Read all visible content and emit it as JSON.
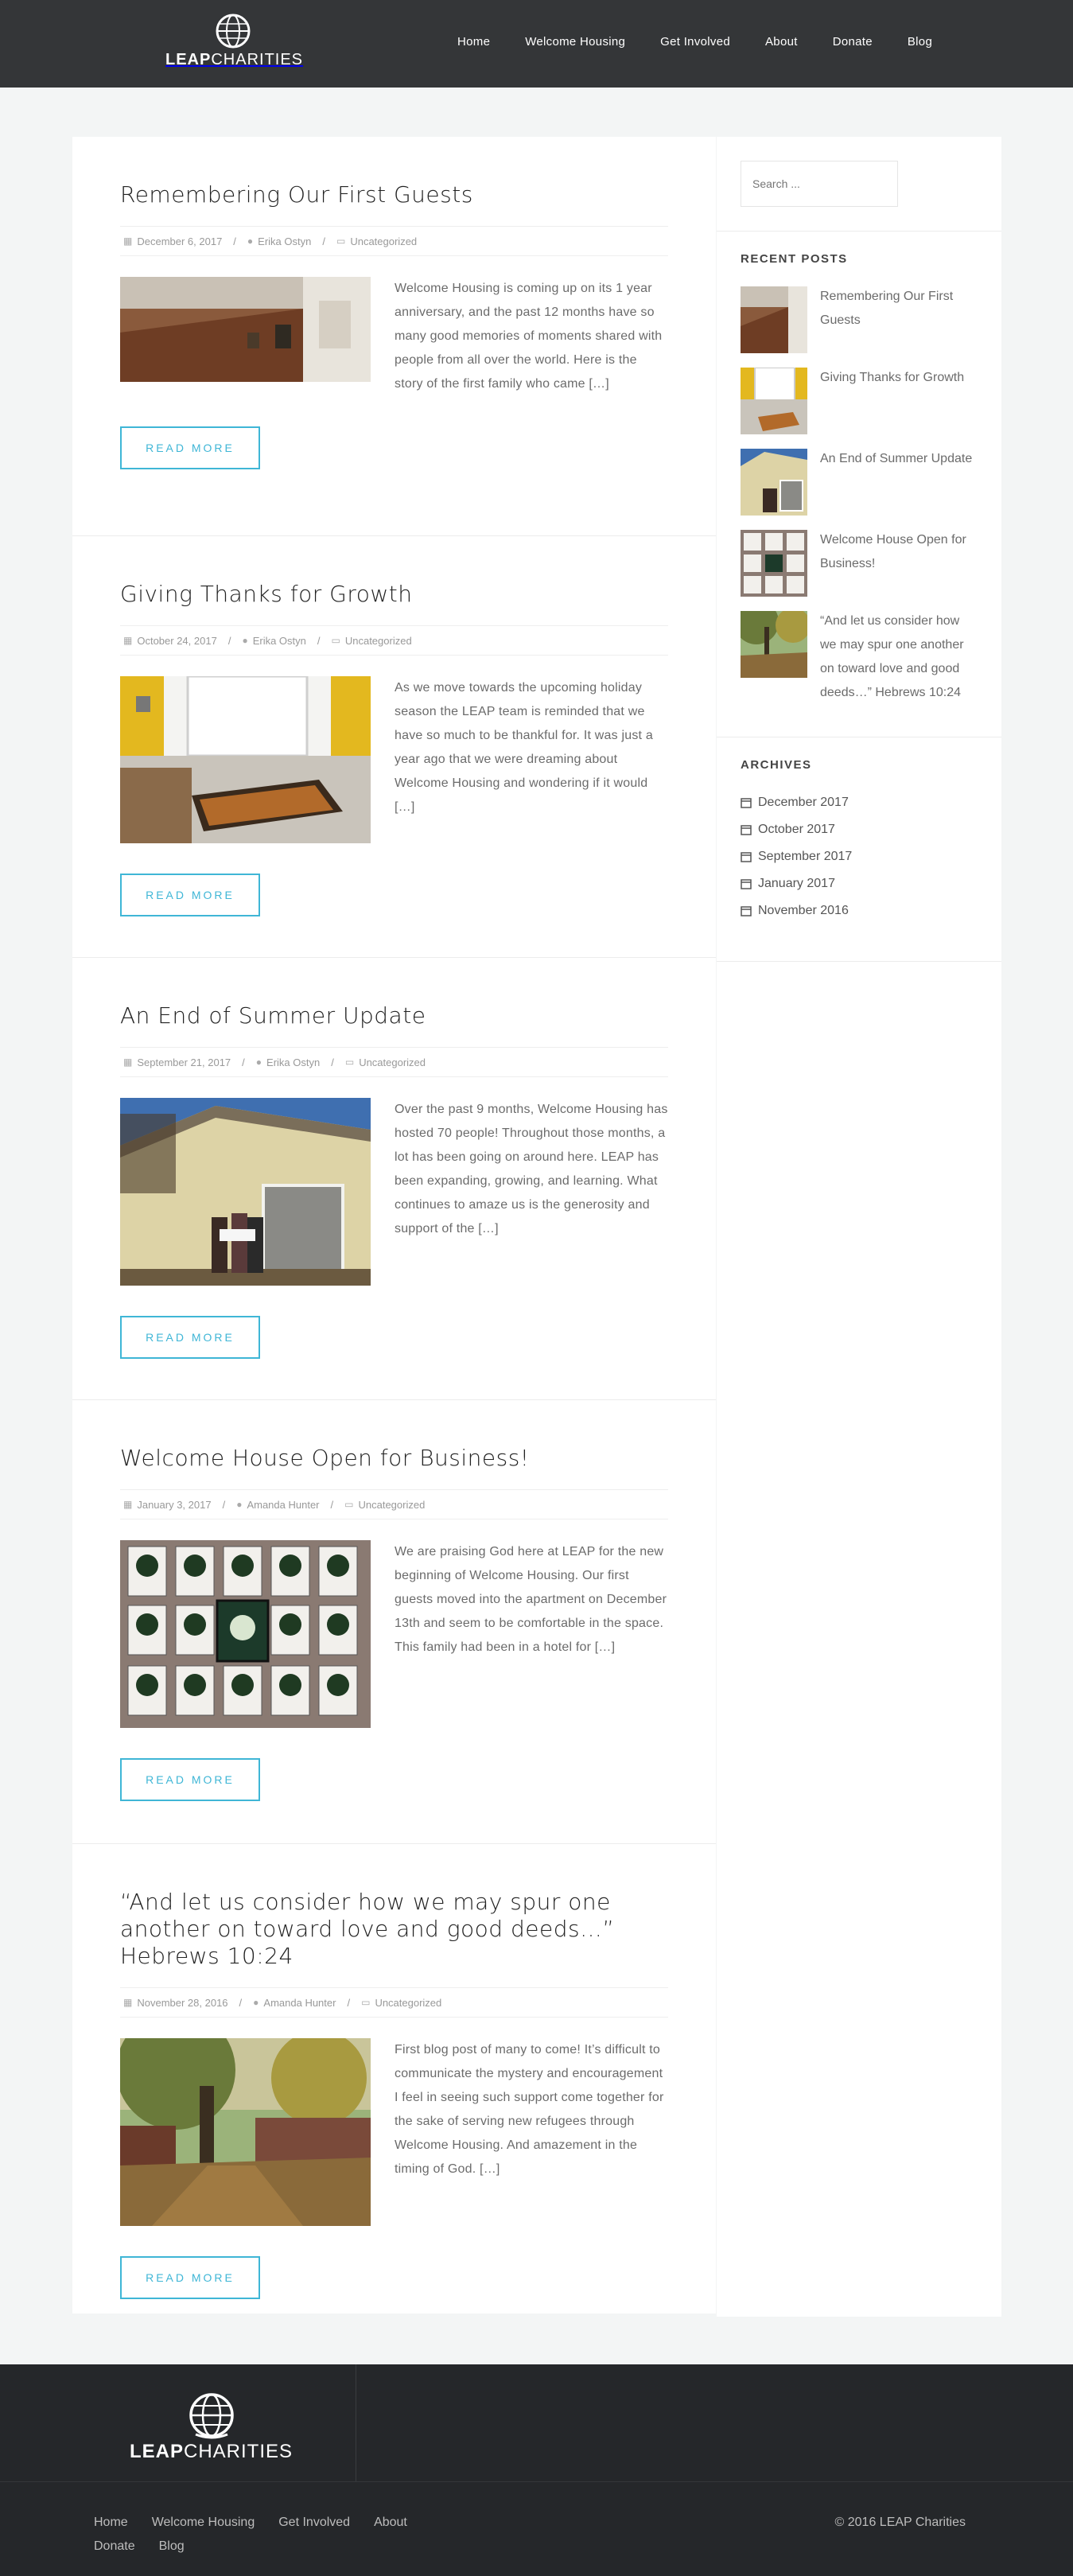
{
  "header": {
    "logo_bold": "LEAP",
    "logo_light": "CHARITIES",
    "nav": [
      "Home",
      "Welcome Housing",
      "Get Involved",
      "About",
      "Donate",
      "Blog"
    ]
  },
  "posts": [
    {
      "title": "Remembering Our First Guests",
      "date": "December 6, 2017",
      "author": "Erika Ostyn",
      "category": "Uncategorized",
      "excerpt": "Welcome Housing is coming up on its 1 year anniversary, and the past 12 months have so many good memories of moments shared with people from all over the world. Here is the story of the first family who came […]",
      "read_more": "READ MORE"
    },
    {
      "title": "Giving Thanks for Growth",
      "date": "October 24, 2017",
      "author": "Erika Ostyn",
      "category": "Uncategorized",
      "excerpt": "As we move towards the upcoming holiday season the LEAP team is reminded that we have so much to be thankful for. It was just a year ago that we were dreaming about Welcome Housing and wondering if it would […]",
      "read_more": "READ MORE"
    },
    {
      "title": "An End of Summer Update",
      "date": "September 21, 2017",
      "author": "Erika Ostyn",
      "category": "Uncategorized",
      "excerpt": "Over the past 9 months, Welcome Housing has hosted 70 people! Throughout those months, a lot has been going on around here. LEAP has been expanding, growing, and learning. What continues to amaze us is the generosity and support of the […]",
      "read_more": "READ MORE"
    },
    {
      "title": "Welcome House Open for Business!",
      "date": "January 3, 2017",
      "author": "Amanda Hunter",
      "category": "Uncategorized",
      "excerpt": "We are praising God here at LEAP for the new beginning of Welcome Housing. Our first guests moved into the apartment on December 13th and seem to be comfortable in the space. This family had been in a hotel for […]",
      "read_more": "READ MORE"
    },
    {
      "title": "“And let us consider how we may spur one another on toward love and good deeds…” Hebrews 10:24",
      "date": "November 28, 2016",
      "author": "Amanda Hunter",
      "category": "Uncategorized",
      "excerpt": "First blog post of many to come!  It’s difficult to communicate the mystery and encouragement I feel in seeing such support come together for the sake of serving new refugees through Welcome Housing.  And amazement in the timing of God. […]",
      "read_more": "READ MORE"
    }
  ],
  "sidebar": {
    "search_placeholder": "Search ...",
    "recent_title": "RECENT POSTS",
    "recent": [
      "Remembering Our First Guests",
      "Giving Thanks for Growth",
      "An End of Summer Update",
      "Welcome House Open for Business!",
      "“And let us consider how we may spur one another on toward love and good deeds…” Hebrews 10:24"
    ],
    "archives_title": "ARCHIVES",
    "archives": [
      "December 2017",
      "October 2017",
      "September 2017",
      "January 2017",
      "November 2016"
    ]
  },
  "footer": {
    "logo_bold": "LEAP",
    "logo_light": "CHARITIES",
    "nav": [
      "Home",
      "Welcome Housing",
      "Get Involved",
      "About",
      "Donate",
      "Blog"
    ],
    "copyright": "© 2016 LEAP Charities"
  },
  "colors": {
    "accent": "#3fb6d6",
    "header_bg": "#343638",
    "footer_bg": "#25272a"
  }
}
